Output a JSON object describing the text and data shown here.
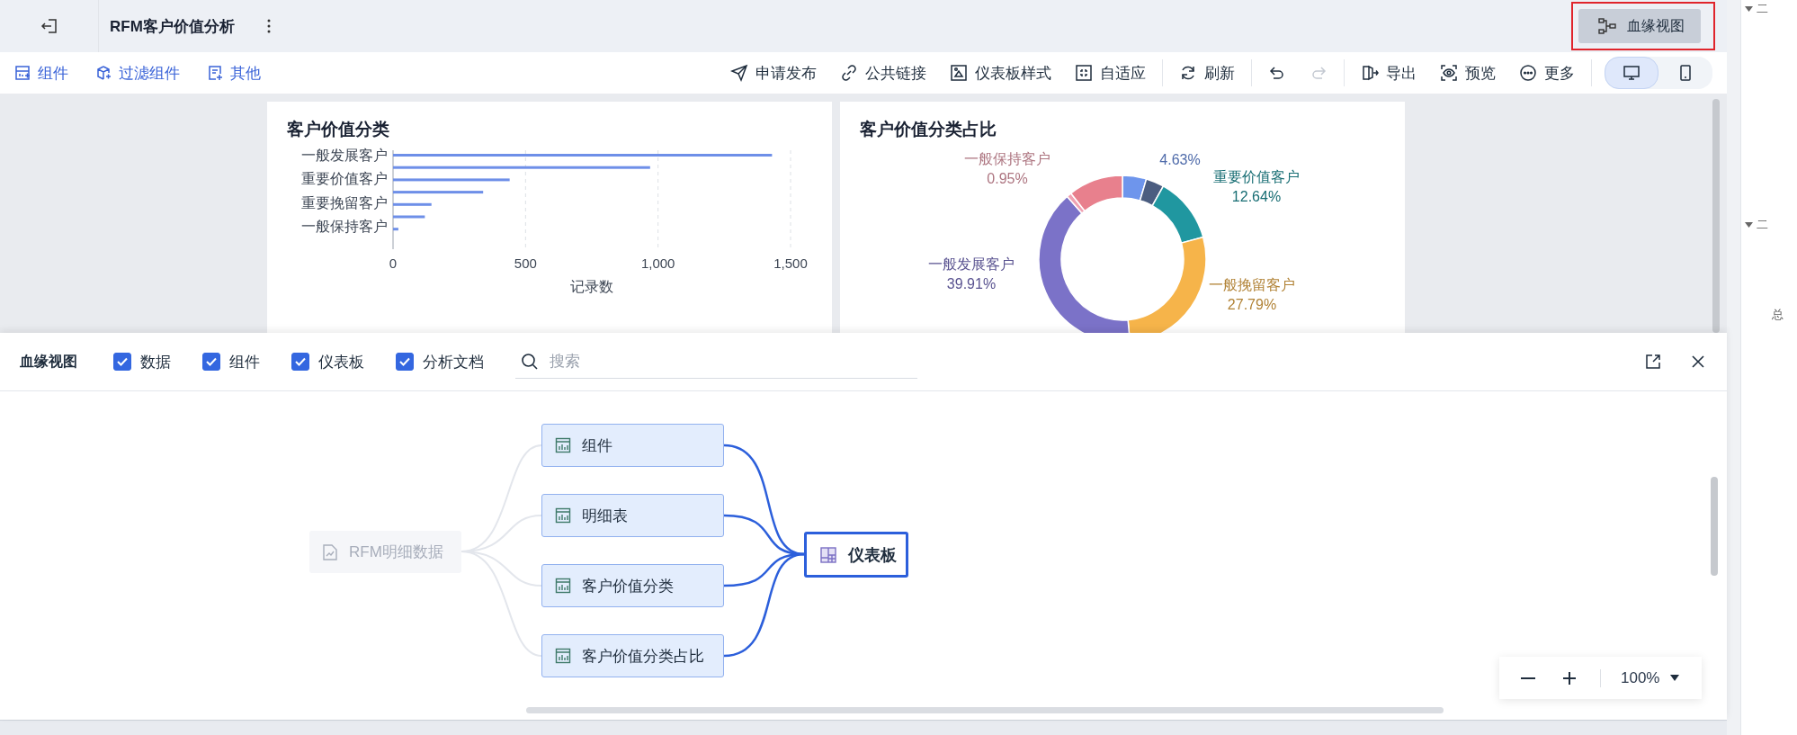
{
  "header": {
    "title": "RFM客户价值分析",
    "lineage_button": {
      "label": "血缘视图",
      "highlighted": true
    }
  },
  "toolbar": {
    "left": [
      {
        "kind": "component",
        "label": "组件"
      },
      {
        "kind": "filter",
        "label": "过滤组件"
      },
      {
        "kind": "other",
        "label": "其他"
      }
    ],
    "right": [
      [
        {
          "kind": "publish",
          "label": "申请发布",
          "disabled": false
        },
        {
          "kind": "link",
          "label": "公共链接",
          "disabled": false
        },
        {
          "kind": "style",
          "label": "仪表板样式",
          "disabled": false
        },
        {
          "kind": "fit",
          "label": "自适应",
          "disabled": false
        }
      ],
      [
        {
          "kind": "refresh",
          "label": "刷新",
          "disabled": false
        }
      ],
      [
        {
          "kind": "undo",
          "disabled": false
        },
        {
          "kind": "redo",
          "disabled": true
        }
      ],
      [
        {
          "kind": "export",
          "label": "导出",
          "disabled": false
        },
        {
          "kind": "preview",
          "label": "预览",
          "disabled": false
        },
        {
          "kind": "more",
          "label": "更多",
          "disabled": false
        }
      ]
    ],
    "devices": [
      {
        "kind": "desktop",
        "selected": true
      },
      {
        "kind": "mobile",
        "selected": false
      }
    ]
  },
  "cards": [
    {
      "title": "客户价值分类",
      "chart_data": {
        "type": "bar",
        "orientation": "horizontal",
        "xlabel": "记录数",
        "categories": [
          "一般发展客户",
          null,
          "重要价值客户",
          null,
          "重要挽留客户",
          null,
          "一般保持客户",
          null
        ],
        "series": [
          {
            "color": "#6e8fe8",
            "values": [
              1430,
              970,
              440,
              340,
              145,
              120,
              20,
              null
            ]
          }
        ],
        "xlim": [
          0,
          1500
        ],
        "xticks": [
          {
            "value": 0,
            "label": "0"
          },
          {
            "value": 500,
            "label": "500"
          },
          {
            "value": 1000,
            "label": "1,000"
          },
          {
            "value": 1500,
            "label": "1,500"
          }
        ]
      }
    },
    {
      "title": "客户价值分类占比",
      "chart_data": {
        "type": "donut",
        "categories": [
          null,
          null,
          "重要价值客户",
          "一般挽留客户",
          "一般发展客户",
          "一般保持客户",
          null
        ],
        "series": [
          {
            "values": [
              4.63,
              3.5,
              12.64,
              27.79,
              39.91,
              0.95,
              10.58
            ]
          }
        ],
        "colors": [
          "#6e95ec",
          "#4b5d80",
          "#2097a0",
          "#f6b44a",
          "#7b72c8",
          "#f0a2b2",
          "#e8808d"
        ],
        "value_labels": [
          "4.63%",
          null,
          "12.64%",
          "27.79%",
          "39.91%",
          "0.95%",
          null
        ]
      }
    }
  ],
  "lineage": {
    "title": "血缘视图",
    "filters": [
      {
        "label": "数据",
        "checked": true
      },
      {
        "label": "组件",
        "checked": true
      },
      {
        "label": "仪表板",
        "checked": true
      },
      {
        "label": "分析文档",
        "checked": true
      }
    ],
    "search": {
      "placeholder": "搜索"
    },
    "source": {
      "label": "RFM明细数据",
      "kind": "dataset",
      "disabled": true
    },
    "middle": [
      {
        "label": "组件",
        "kind": "chart",
        "disabled": false
      },
      {
        "label": "明细表",
        "kind": "chart",
        "disabled": false
      },
      {
        "label": "客户价值分类",
        "kind": "chart",
        "disabled": false
      },
      {
        "label": "客户价值分类占比",
        "kind": "chart",
        "disabled": false
      }
    ],
    "target": {
      "label": "仪表板",
      "kind": "dashboard",
      "selected": true
    },
    "zoom": "100%"
  },
  "side_panel": {
    "items": [
      {
        "kind": "group",
        "label": "二"
      },
      {
        "kind": "group",
        "label": "二"
      },
      {
        "kind": "text",
        "label": "总"
      }
    ]
  }
}
